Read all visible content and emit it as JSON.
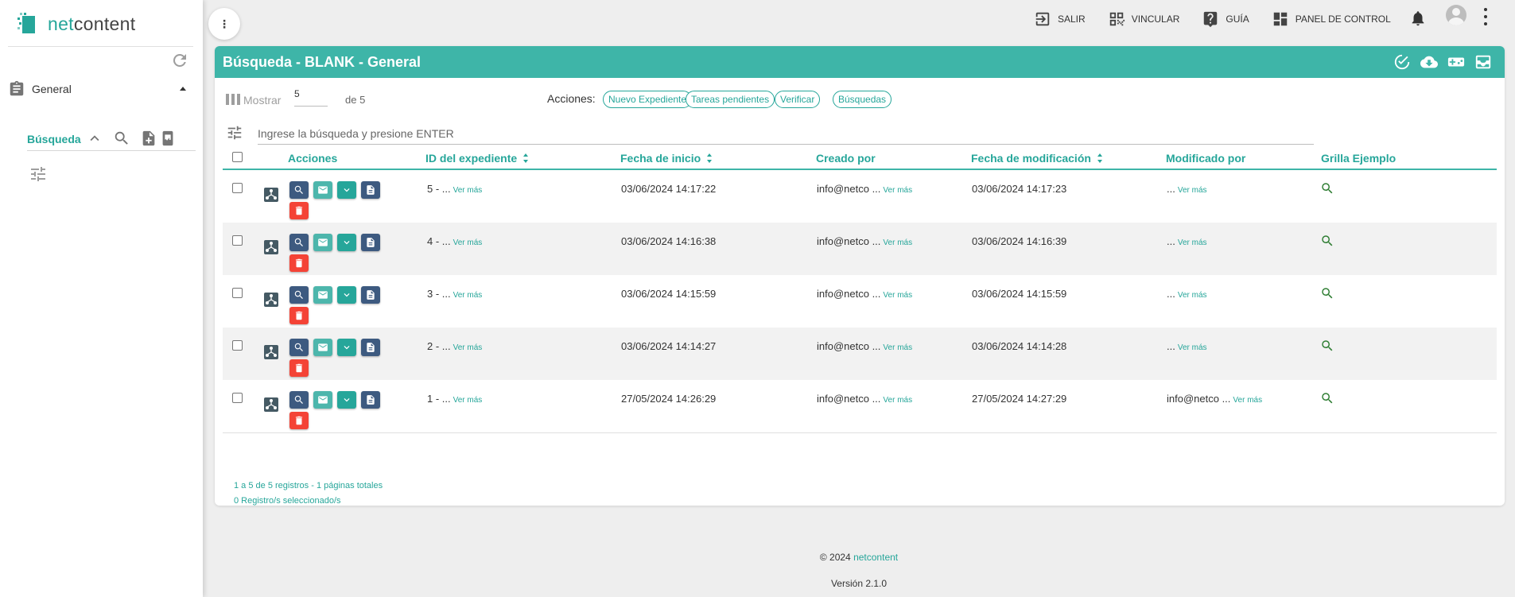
{
  "brand": {
    "prefix": "net",
    "suffix": "content"
  },
  "sidebar": {
    "menu_label": "General",
    "sub_label": "Búsqueda"
  },
  "topnav": {
    "salir": "SALIR",
    "vincular": "VINCULAR",
    "guia": "GUÍA",
    "panel": "PANEL DE CONTROL"
  },
  "card": {
    "title": "Búsqueda - BLANK - General"
  },
  "toolbar": {
    "show_label": "Mostrar",
    "page_size": "5",
    "of_label": "de 5",
    "actions_label": "Acciones:",
    "chips": [
      "Nuevo Expediente",
      "Tareas pendientes",
      "Verificar",
      "Búsquedas"
    ]
  },
  "search": {
    "placeholder": "Ingrese la búsqueda y presione ENTER"
  },
  "table": {
    "headers": {
      "acciones": "Acciones",
      "id": "ID del expediente",
      "inicio": "Fecha de inicio",
      "creado": "Creado por",
      "modif": "Fecha de modificación",
      "modpor": "Modificado por",
      "grilla": "Grilla Ejemplo"
    },
    "ver_mas": "Ver más",
    "rows": [
      {
        "id": "5 - ...",
        "inicio": "03/06/2024 14:17:22",
        "creado": "info@netco ...",
        "modif": "03/06/2024 14:17:23",
        "modpor": "..."
      },
      {
        "id": "4 - ...",
        "inicio": "03/06/2024 14:16:38",
        "creado": "info@netco ...",
        "modif": "03/06/2024 14:16:39",
        "modpor": "..."
      },
      {
        "id": "3 - ...",
        "inicio": "03/06/2024 14:15:59",
        "creado": "info@netco ...",
        "modif": "03/06/2024 14:15:59",
        "modpor": "..."
      },
      {
        "id": "2 - ...",
        "inicio": "03/06/2024 14:14:27",
        "creado": "info@netco ...",
        "modif": "03/06/2024 14:14:28",
        "modpor": "..."
      },
      {
        "id": "1 - ...",
        "inicio": "27/05/2024 14:26:29",
        "creado": "info@netco ...",
        "modif": "27/05/2024 14:27:29",
        "modpor": "info@netco ..."
      }
    ]
  },
  "footer": {
    "records": "1 a 5 de 5 registros - 1 páginas totales",
    "selected": "0 Registro/s seleccionado/s",
    "copyright_prefix": "© 2024",
    "copyright_brand": "netcontent",
    "version": "Versión 2.1.0"
  },
  "colors": {
    "accent": "#26a69a",
    "header": "#3eb5a8",
    "delete": "#f44336",
    "navy": "#3d5a80"
  }
}
